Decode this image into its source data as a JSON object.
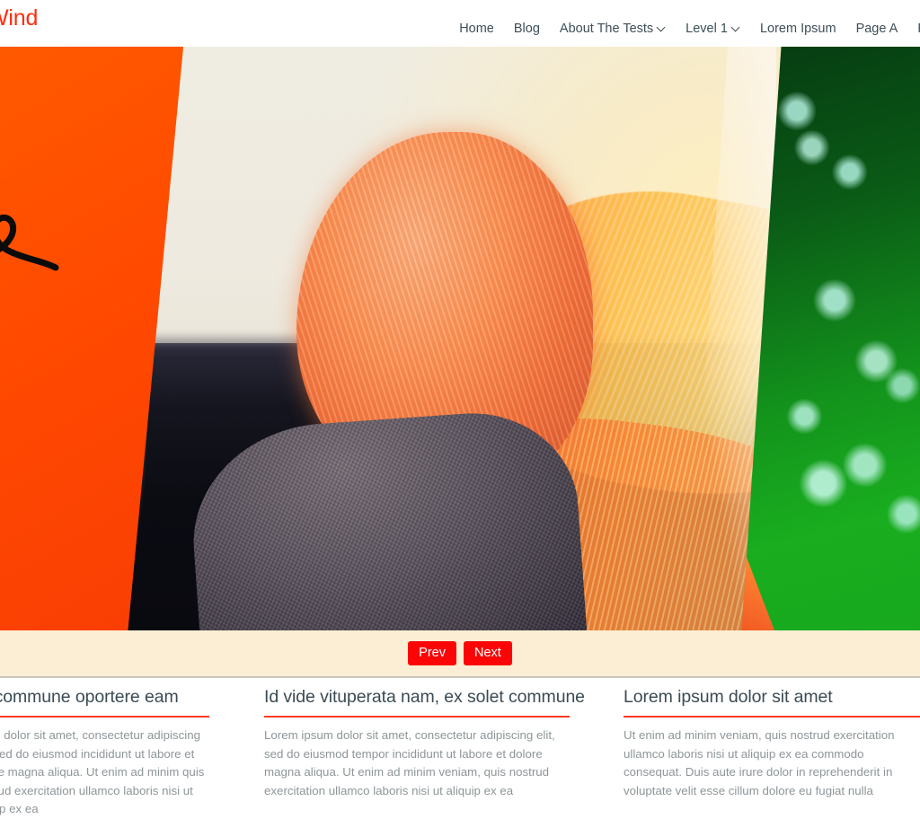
{
  "header": {
    "brand": "Wind",
    "brand_color": "#ff2d0d",
    "nav": [
      {
        "label": "Home",
        "has_dropdown": false
      },
      {
        "label": "Blog",
        "has_dropdown": false
      },
      {
        "label": "About The Tests",
        "has_dropdown": true
      },
      {
        "label": "Level 1",
        "has_dropdown": true
      },
      {
        "label": "Lorem Ipsum",
        "has_dropdown": false
      },
      {
        "label": "Page A",
        "has_dropdown": false
      },
      {
        "label": "P",
        "has_dropdown": false
      }
    ]
  },
  "hero": {
    "slide_alt": "woman with wind-blown orange hair at sunset",
    "prev_label": "Prev",
    "next_label": "Next",
    "control_bg": "#fceed4",
    "button_color": "#fb0606"
  },
  "features": {
    "accent_rule_color": "#fb3a22",
    "columns": [
      {
        "title": "let commune oportere eam",
        "body": "psum dolor sit amet, consectetur adipiscing elit, sed do eiusmod incididunt ut labore et dolore magna aliqua. Ut enim ad minim quis nostrud exercitation ullamco laboris nisi ut aliquip ex ea"
      },
      {
        "title": "Id vide vituperata nam, ex solet commune",
        "body": "Lorem ipsum dolor sit amet, consectetur adipiscing elit, sed do eiusmod tempor incididunt ut labore et dolore magna aliqua. Ut enim ad minim veniam, quis nostrud exercitation ullamco laboris nisi ut aliquip ex ea"
      },
      {
        "title": "Lorem ipsum dolor sit amet",
        "body": "Ut enim ad minim veniam, quis nostrud exercitation ullamco laboris nisi ut aliquip ex ea commodo consequat. Duis aute irure dolor in reprehenderit in voluptate velit esse cillum dolore eu fugiat nulla"
      }
    ]
  }
}
